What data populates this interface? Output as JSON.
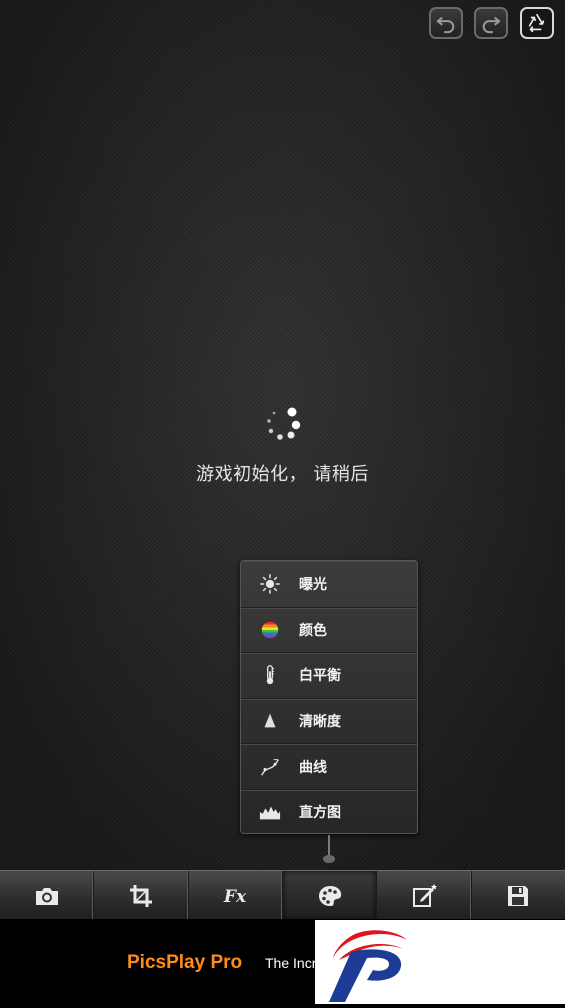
{
  "header": {
    "undo_icon": "undo-arrow-icon",
    "redo_icon": "redo-arrow-icon",
    "reset_icon": "recycle-icon"
  },
  "loading": {
    "message": "游戏初始化， 请稍后"
  },
  "adjust_menu": {
    "items": [
      {
        "label": "曝光",
        "icon": "sun-icon"
      },
      {
        "label": "颜色",
        "icon": "color-ball-icon"
      },
      {
        "label": "白平衡",
        "icon": "thermometer-icon"
      },
      {
        "label": "清晰度",
        "icon": "triangle-icon"
      },
      {
        "label": "曲线",
        "icon": "curve-icon"
      },
      {
        "label": "直方图",
        "icon": "histogram-icon"
      }
    ]
  },
  "toolbar": {
    "items": [
      {
        "icon": "camera-icon",
        "active": false
      },
      {
        "icon": "crop-icon",
        "active": false
      },
      {
        "icon": "fx-icon",
        "label": "Fx",
        "active": false
      },
      {
        "icon": "palette-icon",
        "active": true
      },
      {
        "icon": "edit-icon",
        "active": false
      },
      {
        "icon": "save-icon",
        "active": false
      }
    ]
  },
  "ad": {
    "title": "PicsPlay Pro",
    "tagline": "The Incr"
  },
  "colors": {
    "background": "#2c2c2c",
    "ad_title": "#ff8c1a",
    "logo_red": "#e0141e",
    "logo_blue": "#1e3c96"
  }
}
